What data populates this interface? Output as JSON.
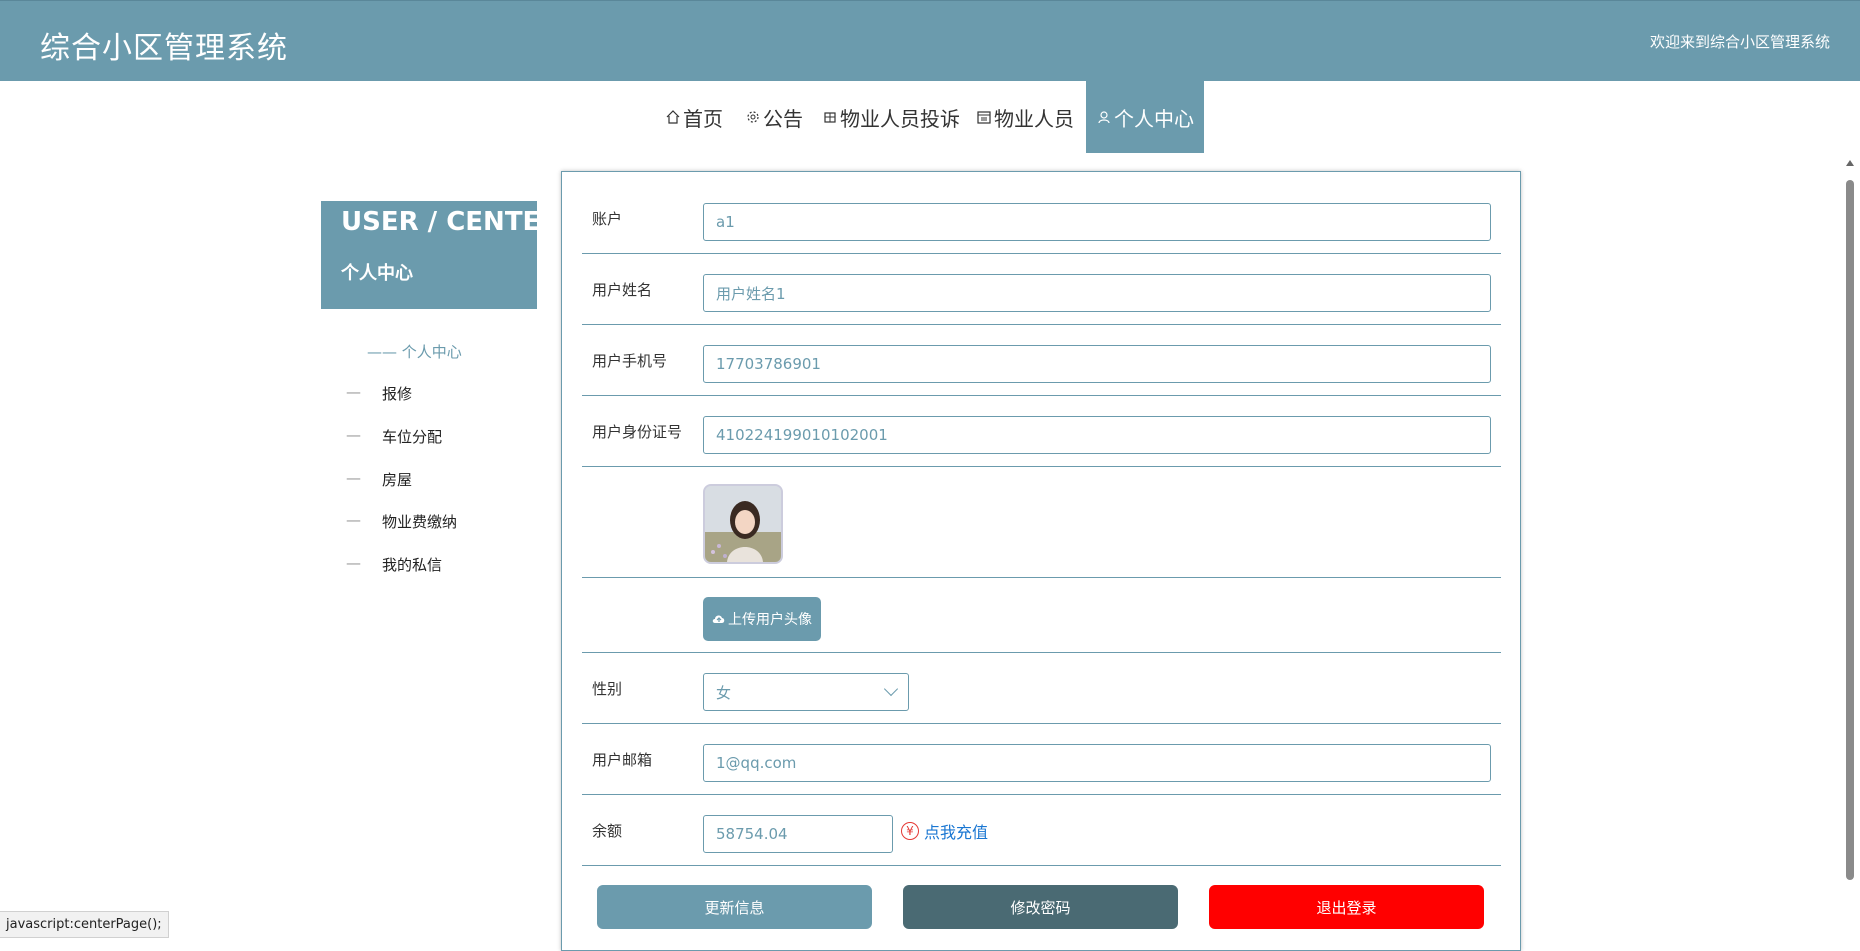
{
  "header": {
    "title": "综合小区管理系统",
    "welcome": "欢迎来到综合小区管理系统"
  },
  "nav": {
    "items": [
      {
        "label": "首页",
        "icon": "home-icon"
      },
      {
        "label": "公告",
        "icon": "bell-icon"
      },
      {
        "label": "物业人员投诉",
        "icon": "box-icon"
      },
      {
        "label": "物业人员",
        "icon": "calendar-icon"
      },
      {
        "label": "个人中心",
        "icon": "user-icon",
        "active": true
      }
    ]
  },
  "sidebar": {
    "title_en": "USER / CENTER",
    "title_cn": "个人中心",
    "items": [
      {
        "label": "个人中心",
        "active": true,
        "dash": "——"
      },
      {
        "label": "报修",
        "dash": "—"
      },
      {
        "label": "车位分配",
        "dash": "—"
      },
      {
        "label": "房屋",
        "dash": "—"
      },
      {
        "label": "物业费缴纳",
        "dash": "—"
      },
      {
        "label": "我的私信",
        "dash": "—"
      }
    ]
  },
  "form": {
    "account": {
      "label": "账户",
      "value": "a1"
    },
    "name": {
      "label": "用户姓名",
      "value": "用户姓名1"
    },
    "phone": {
      "label": "用户手机号",
      "value": "17703786901"
    },
    "idcard": {
      "label": "用户身份证号",
      "value": "410224199010102001"
    },
    "upload_label": "上传用户头像",
    "gender": {
      "label": "性别",
      "value": "女"
    },
    "email": {
      "label": "用户邮箱",
      "value": "1@qq.com"
    },
    "balance": {
      "label": "余额",
      "value": "58754.04",
      "recharge_label": "点我充值",
      "yen": "¥"
    }
  },
  "actions": {
    "update": "更新信息",
    "change_password": "修改密码",
    "logout": "退出登录"
  },
  "colors": {
    "primary": "#6b9bad",
    "dark": "#4a6a73",
    "danger": "#ff0000",
    "link": "#1976d2"
  },
  "status_tip": "javascript:centerPage();"
}
